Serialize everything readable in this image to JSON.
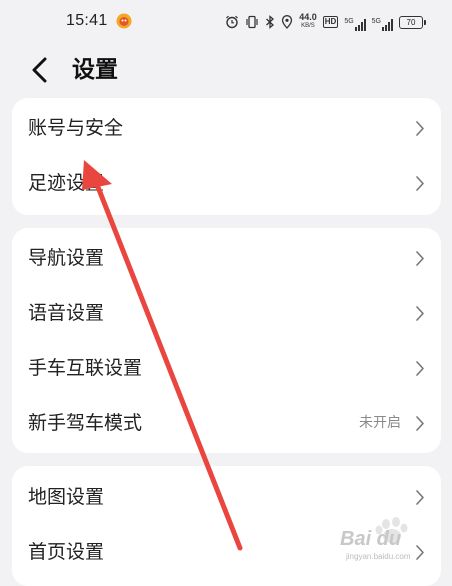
{
  "status_bar": {
    "time": "15:41",
    "net_speed_value": "44.0",
    "net_speed_unit": "KB/S",
    "hd_label": "HD",
    "sig1_label": "5G",
    "sig2_label": "5G",
    "battery_level": "70"
  },
  "header": {
    "title": "设置"
  },
  "groups": [
    {
      "items": [
        {
          "label": "账号与安全",
          "value": ""
        },
        {
          "label": "足迹设置",
          "value": ""
        }
      ]
    },
    {
      "items": [
        {
          "label": "导航设置",
          "value": ""
        },
        {
          "label": "语音设置",
          "value": ""
        },
        {
          "label": "手车互联设置",
          "value": ""
        },
        {
          "label": "新手驾车模式",
          "value": "未开启"
        }
      ]
    },
    {
      "items": [
        {
          "label": "地图设置",
          "value": ""
        },
        {
          "label": "首页设置",
          "value": ""
        }
      ]
    }
  ],
  "watermark": {
    "text": "Bai du",
    "sub": "jingyan.baidu.com"
  },
  "colors": {
    "background": "#f2f2f4",
    "card": "#ffffff",
    "annotation_arrow": "#e8463f"
  }
}
